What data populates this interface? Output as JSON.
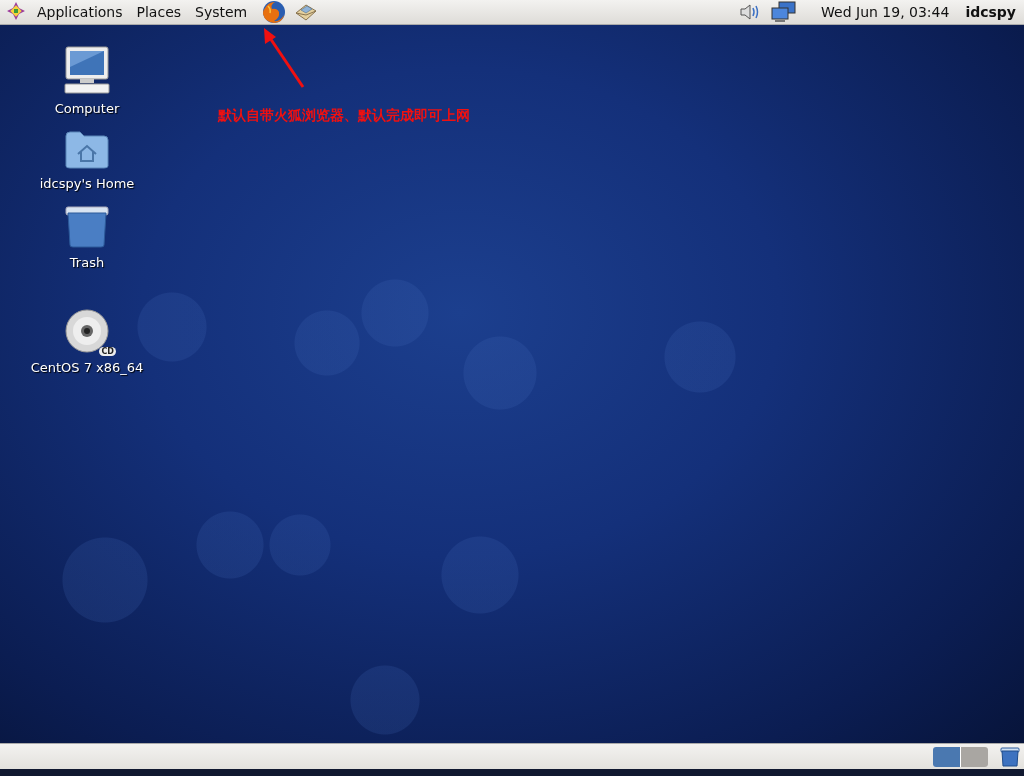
{
  "top_panel": {
    "menus": [
      {
        "label": "Applications"
      },
      {
        "label": "Places"
      },
      {
        "label": "System"
      }
    ],
    "launchers": [
      {
        "kind": "browser"
      },
      {
        "kind": "mail"
      }
    ],
    "tray": [
      {
        "kind": "volume"
      },
      {
        "kind": "network"
      }
    ],
    "clock": "Wed Jun 19, 03:44",
    "user": "idcspy"
  },
  "desktop": {
    "icons": [
      {
        "kind": "computer",
        "label": "Computer"
      },
      {
        "kind": "home",
        "label": "idcspy's Home"
      },
      {
        "kind": "trash",
        "label": "Trash"
      },
      {
        "kind": "disc",
        "label": "CentOS 7 x86_64",
        "badge": "CD"
      }
    ],
    "annotation": {
      "text": "默认自带火狐浏览器、默认完成即可上网"
    }
  },
  "bottom_panel": {
    "workspaces": [
      {
        "selected": true
      },
      {
        "selected": false
      }
    ],
    "applets": [
      {
        "kind": "trash"
      }
    ]
  }
}
